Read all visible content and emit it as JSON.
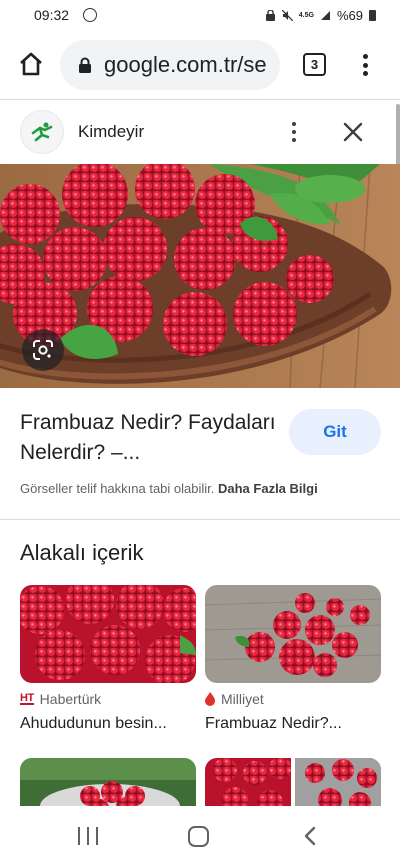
{
  "status_bar": {
    "time": "09:32",
    "network": "4.5G",
    "battery": "%69"
  },
  "browser": {
    "url": "google.com.tr/se",
    "tab_count": "3"
  },
  "panel": {
    "site_name": "Kimdeyir",
    "result_title": "Frambuaz Nedir? Faydaları Nelerdir? –...",
    "visit_label": "Git",
    "copyright_text": "Görseller telif hakkına tabi olabilir.",
    "more_info_label": "Daha Fazla Bilgi"
  },
  "related": {
    "heading": "Alakalı içerik",
    "cards": [
      {
        "source_badge": "HT",
        "source": "Habertürk",
        "title": "Ahududunun besin..."
      },
      {
        "source": "Milliyet",
        "title": "Frambuaz Nedir?..."
      }
    ]
  },
  "colors": {
    "accent_blue": "#1a73e8",
    "visit_button_bg": "#e8f0fe",
    "habertürk_red": "#c8102e",
    "milliyet_red": "#e0322b"
  },
  "icons": {
    "home": "home-icon",
    "lock": "lock-icon",
    "lens": "google-lens-icon",
    "close": "close-icon"
  }
}
